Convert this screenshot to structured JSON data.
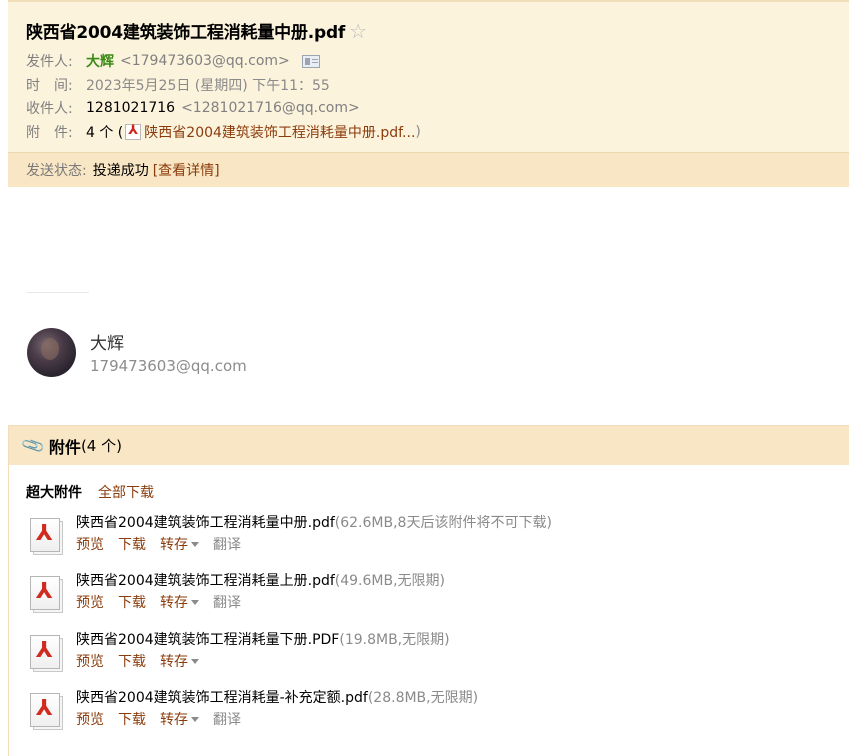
{
  "header": {
    "subject": "陕西省2004建筑装饰工程消耗量中册.pdf",
    "star_icon": "star-outline-icon",
    "sender_label": "发件人:",
    "sender_name": "大辉",
    "sender_email": "<179473603@qq.com>",
    "time_label": "时　间:",
    "time_value": "2023年5月25日 (星期四) 下午11：55",
    "recipient_label": "收件人:",
    "recipient_name": "1281021716",
    "recipient_email": "<1281021716@qq.com>",
    "attachment_label": "附　件:",
    "attachment_count": "4 个 (",
    "attachment_first": "陕西省2004建筑装饰工程消耗量中册.pdf...",
    "attachment_close": ")"
  },
  "status": {
    "label": "发送状态:",
    "value": "投递成功",
    "detail_link": "[查看详情]"
  },
  "signature": {
    "name": "大辉",
    "email": "179473603@qq.com"
  },
  "attachments": {
    "title": "附件",
    "count": "(4 个)",
    "sub_label": "超大附件",
    "download_all": "全部下载",
    "actions": {
      "preview": "预览",
      "download": "下载",
      "forward": "转存",
      "translate": "翻译"
    },
    "items": [
      {
        "name": "陕西省2004建筑装饰工程消耗量中册.pdf",
        "info": "(62.6MB,8天后该附件将不可下载)",
        "translate": true
      },
      {
        "name": "陕西省2004建筑装饰工程消耗量上册.pdf",
        "info": "(49.6MB,无限期)",
        "translate": true
      },
      {
        "name": "陕西省2004建筑装饰工程消耗量下册.PDF",
        "info": "(19.8MB,无限期)",
        "translate": false
      },
      {
        "name": "陕西省2004建筑装饰工程消耗量-补充定额.pdf",
        "info": "(28.8MB,无限期)",
        "translate": true
      }
    ]
  }
}
